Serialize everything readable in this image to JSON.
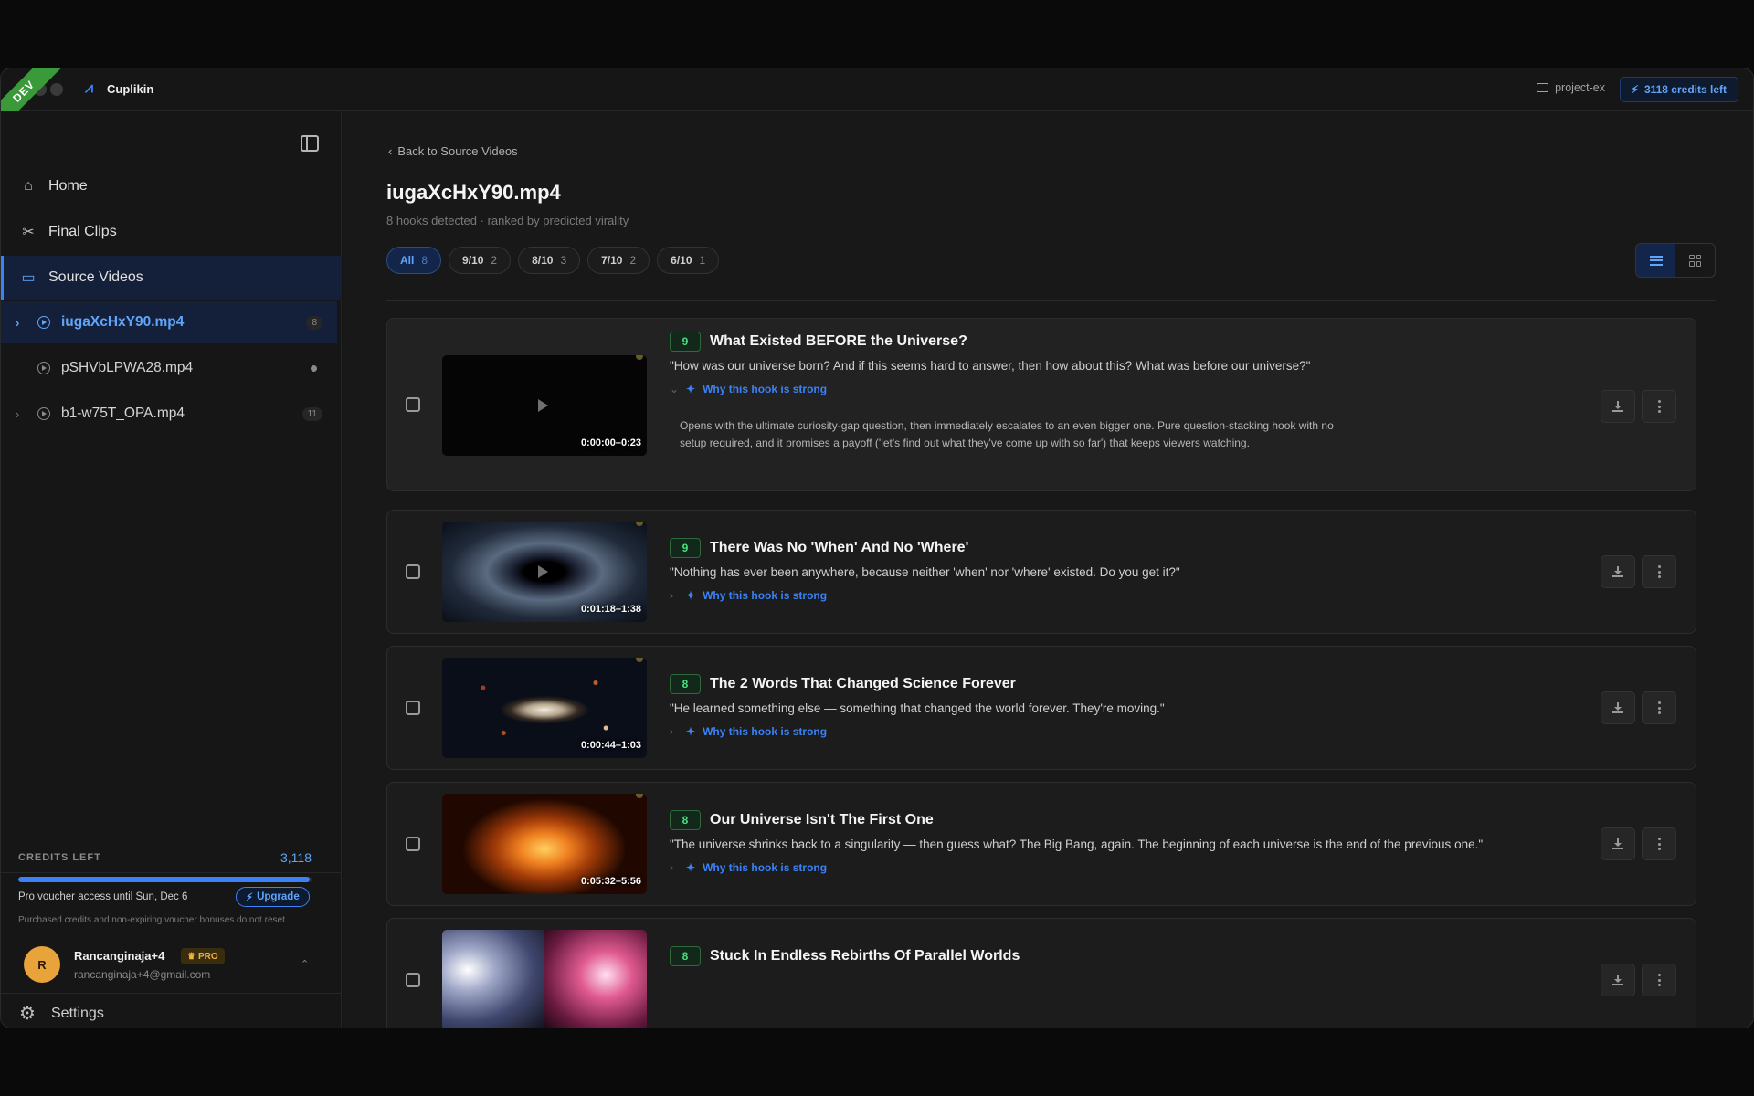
{
  "app": {
    "name": "Cuplikin",
    "env_badge": "DEV",
    "project": "project-ex",
    "credits_pill": "3118 credits left"
  },
  "sidebar": {
    "nav": [
      {
        "label": "Home",
        "icon": "home-icon"
      },
      {
        "label": "Final Clips",
        "icon": "scissors-icon"
      },
      {
        "label": "Source Videos",
        "icon": "video-folder-icon"
      }
    ],
    "videos": [
      {
        "label": "iugaXcHxY90.mp4",
        "count": "8",
        "active": true
      },
      {
        "label": "pSHVbLPWA28.mp4",
        "status": "dot"
      },
      {
        "label": "b1-w75T_OPA.mp4",
        "count": "11"
      }
    ],
    "credits": {
      "label": "CREDITS LEFT",
      "value": "3,118",
      "fill_fraction": 0.99,
      "voucher": "Pro voucher access until Sun, Dec 6",
      "upgrade": "Upgrade",
      "note": "Purchased credits and non-expiring voucher bonuses do not reset."
    },
    "user": {
      "initial": "R",
      "name": "Rancanginaja+4",
      "badge": "PRO",
      "email": "rancanginaja+4@gmail.com"
    },
    "settings": "Settings"
  },
  "main": {
    "back": "Back to Source Videos",
    "title": "iugaXcHxY90.mp4",
    "subtitle": "8 hooks detected · ranked by predicted virality",
    "filters": [
      {
        "label": "All",
        "count": "8",
        "active": true
      },
      {
        "label": "9/10",
        "count": "2"
      },
      {
        "label": "8/10",
        "count": "3"
      },
      {
        "label": "7/10",
        "count": "2"
      },
      {
        "label": "6/10",
        "count": "1"
      }
    ],
    "why_label": "Why this hook is strong",
    "hooks": [
      {
        "score": "9",
        "title": "What Existed BEFORE the Universe?",
        "quote": "\"How was our universe born? And if this seems hard to answer, then how about this? What was before our universe?\"",
        "time": "0:00:00–0:23",
        "explanation": "Opens with the ultimate curiosity-gap question, then immediately escalates to an even bigger one. Pure question-stacking hook with no setup required, and it promises a payoff ('let's find out what they've come up with so far') that keeps viewers watching."
      },
      {
        "score": "9",
        "title": "There Was No 'When' And No 'Where'",
        "quote": "\"Nothing has ever been anywhere, because neither 'when' nor 'where' existed. Do you get it?\"",
        "time": "0:01:18–1:38"
      },
      {
        "score": "8",
        "title": "The 2 Words That Changed Science Forever",
        "quote": "\"He learned something else — something that changed the world forever. They're moving.\"",
        "time": "0:00:44–1:03"
      },
      {
        "score": "8",
        "title": "Our Universe Isn't The First One",
        "quote": "\"The universe shrinks back to a singularity — then guess what? The Big Bang, again. The beginning of each universe is the end of the previous one.\"",
        "time": "0:05:32–5:56"
      },
      {
        "score": "8",
        "title": "Stuck In Endless Rebirths Of Parallel Worlds"
      }
    ]
  }
}
